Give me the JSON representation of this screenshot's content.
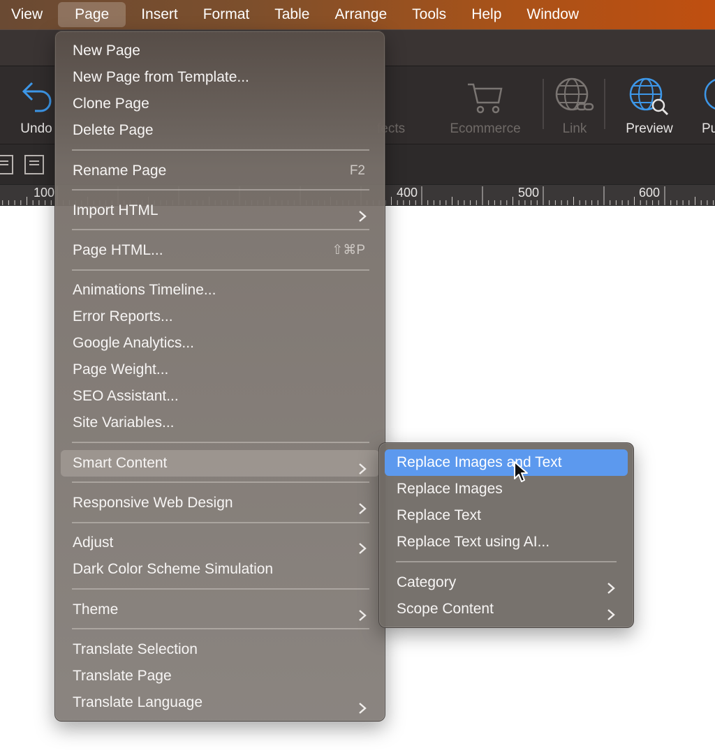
{
  "menubar": {
    "items": [
      {
        "label": "View"
      },
      {
        "label": "Page"
      },
      {
        "label": "Insert"
      },
      {
        "label": "Format"
      },
      {
        "label": "Table"
      },
      {
        "label": "Arrange"
      },
      {
        "label": "Tools"
      },
      {
        "label": "Help"
      },
      {
        "label": "Window"
      }
    ]
  },
  "toolbar": {
    "undo": "Undo",
    "effects": "fects",
    "ecommerce": "Ecommerce",
    "link": "Link",
    "preview": "Preview",
    "publish": "Pu"
  },
  "ruler": {
    "labels": [
      "100",
      "400",
      "500",
      "600"
    ]
  },
  "page_menu": {
    "new_page": "New Page",
    "new_page_template": "New Page from Template...",
    "clone_page": "Clone Page",
    "delete_page": "Delete Page",
    "rename_page": "Rename Page",
    "rename_shortcut": "F2",
    "import_html": "Import HTML",
    "page_html": "Page HTML...",
    "page_html_shortcut": "⇧⌘P",
    "animations_timeline": "Animations Timeline...",
    "error_reports": "Error Reports...",
    "google_analytics": "Google Analytics...",
    "page_weight": "Page Weight...",
    "seo_assistant": "SEO Assistant...",
    "site_variables": "Site Variables...",
    "smart_content": "Smart Content",
    "responsive_web_design": "Responsive Web Design",
    "adjust": "Adjust",
    "dark_color_scheme": "Dark Color Scheme Simulation",
    "theme": "Theme",
    "translate_selection": "Translate Selection",
    "translate_page": "Translate Page",
    "translate_language": "Translate Language"
  },
  "smart_content_menu": {
    "replace_images_and_text": "Replace Images and Text",
    "replace_images": "Replace Images",
    "replace_text": "Replace Text",
    "replace_text_ai": "Replace Text using AI...",
    "category": "Category",
    "scope_content": "Scope Content"
  },
  "icons": {
    "undo": "undo-arrow-icon",
    "ecommerce": "shopping-cart-icon",
    "link": "globe-link-icon",
    "preview": "globe-search-icon",
    "submenu": "chevron-right-icon",
    "cursor": "mouse-pointer-icon"
  },
  "colors": {
    "selection": "#5c99ee",
    "preview_icon": "#3d97e8"
  }
}
